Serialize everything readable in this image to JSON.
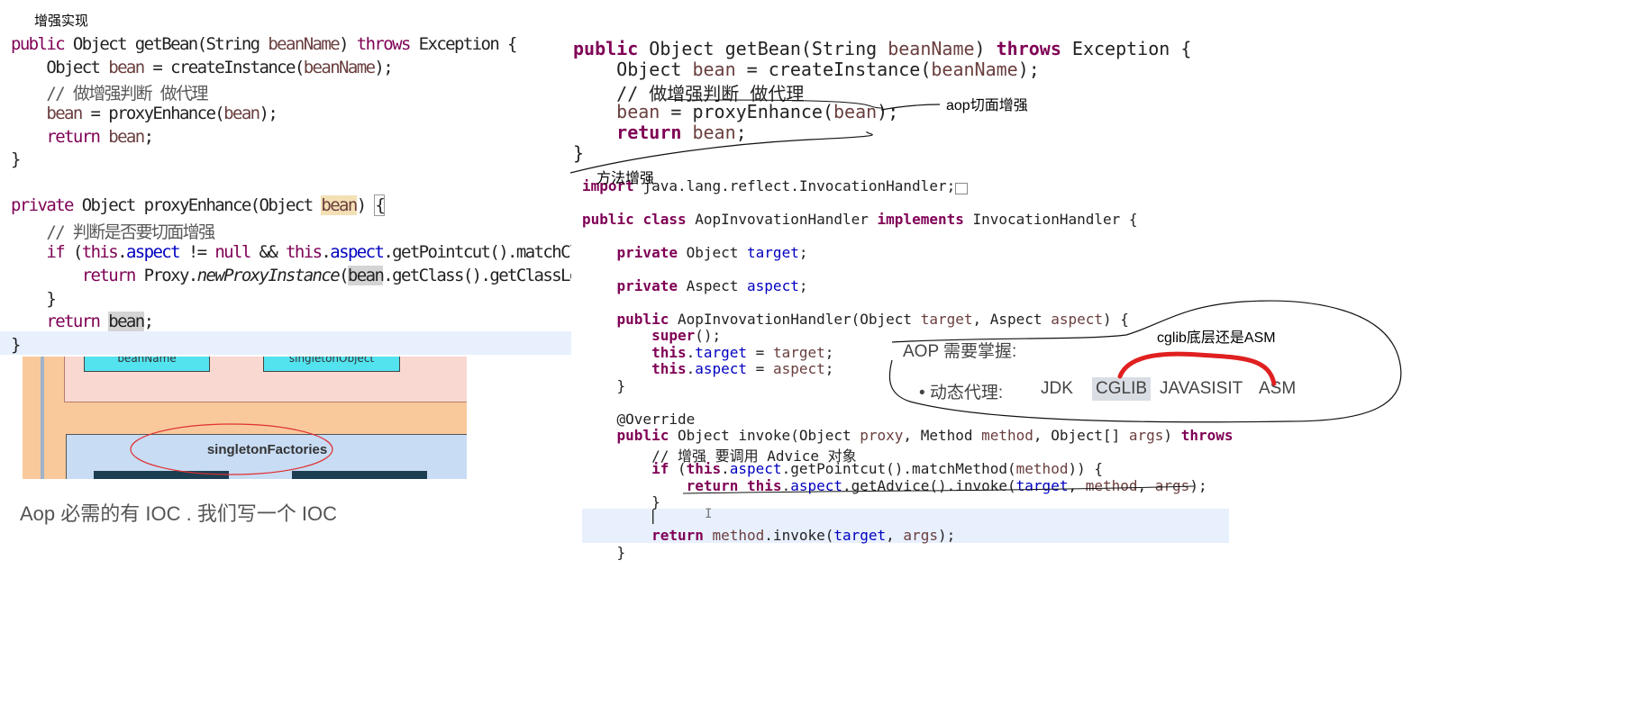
{
  "header_note": "增强实现",
  "left_code": {
    "lines": [
      "public Object getBean(String beanName) throws Exception {",
      "    Object bean = createInstance(beanName);",
      "    // 做增强判断 做代理",
      "    bean = proxyEnhance(bean);",
      "    return bean;",
      "}",
      "",
      "private Object proxyEnhance(Object bean) {",
      "    // 判断是否要切面增强",
      "    if (this.aspect != null && this.aspect.getPointcut().matchClass(bean.getCl",
      "        return Proxy.newProxyInstance(bean.getClass().getClassLoader(), bean.g",
      "    }",
      "    return bean;",
      "}"
    ]
  },
  "diagram": {
    "label_left": "beanName",
    "label_right": "singletonObject",
    "label_bottom": "singletonFactories"
  },
  "caption": "Aop   必需的有  IOC  .  我们写一个 IOC",
  "top_right_code": {
    "lines": [
      "public Object getBean(String beanName) throws Exception {",
      "    Object bean = createInstance(beanName);",
      "    // 做增强判断 做代理",
      "    bean = proxyEnhance(bean);",
      "    return bean;",
      "}"
    ]
  },
  "annotations": {
    "aop_note": "aop切面增强",
    "method_note": "方法增强",
    "cglib_note": "cglib底层还是ASM"
  },
  "bottom_right_code": {
    "lines": [
      "import java.lang.reflect.InvocationHandler;",
      "",
      "public class AopInvovationHandler implements InvocationHandler {",
      "",
      "    private Object target;",
      "",
      "    private Aspect aspect;",
      "",
      "    public AopInvovationHandler(Object target, Aspect aspect) {",
      "        super();",
      "        this.target = target;",
      "        this.aspect = aspect;",
      "    }",
      "",
      "    @Override",
      "    public Object invoke(Object proxy, Method method, Object[] args) throws",
      "        // 增强 要调用 Advice 对象",
      "        if (this.aspect.getPointcut().matchMethod(method)) {",
      "            return this.aspect.getAdvice().invoke(target, method, args);",
      "        }",
      "",
      "        return method.invoke(target, args);",
      "    }"
    ]
  },
  "aop_box": {
    "title": "AOP 需要掌握:",
    "bullet_label": "• 动态代理:",
    "items": [
      "JDK",
      "CGLIB",
      "JAVASISIT",
      "ASM"
    ]
  },
  "colors": {
    "keyword": "#7f0055",
    "field": "#0000c0",
    "comment": "#3f7f5f",
    "red_pen": "#e02020",
    "highlight_row": "#e8f0fe"
  }
}
